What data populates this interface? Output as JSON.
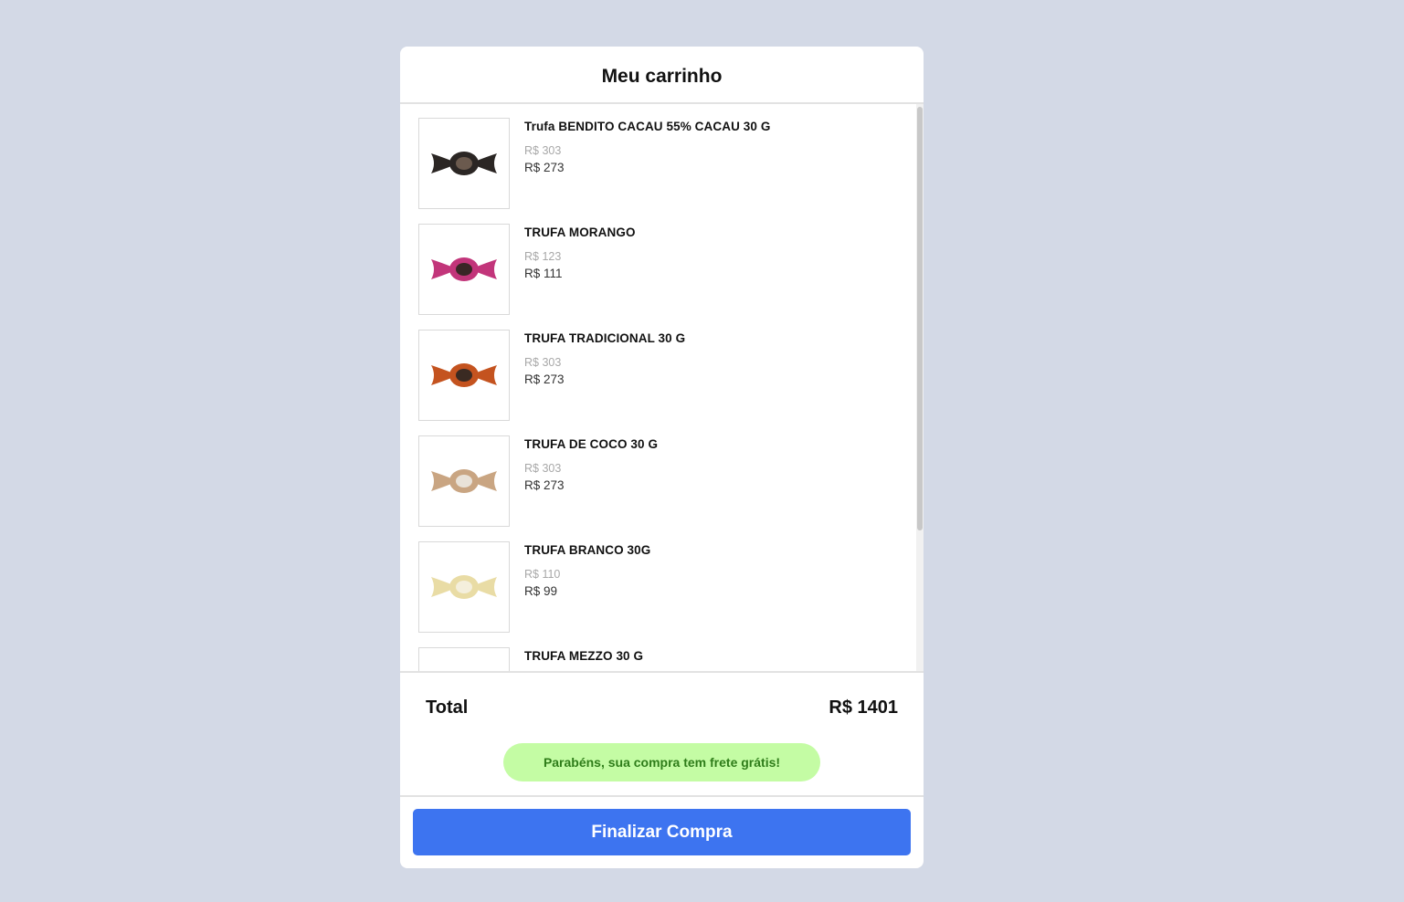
{
  "cart": {
    "title": "Meu carrinho",
    "items": [
      {
        "name": "Trufa BENDITO CACAU 55% CACAU 30 G",
        "old_price": "R$ 303",
        "price": "R$ 273",
        "wrapper_color": "#2b2624",
        "accent_color": "#6b5a4e"
      },
      {
        "name": "TRUFA MORANGO",
        "old_price": "R$ 123",
        "price": "R$ 111",
        "wrapper_color": "#c2357a",
        "accent_color": "#3a2626"
      },
      {
        "name": "TRUFA TRADICIONAL 30 G",
        "old_price": "R$ 303",
        "price": "R$ 273",
        "wrapper_color": "#c4531f",
        "accent_color": "#3a2a22"
      },
      {
        "name": "TRUFA DE COCO 30 G",
        "old_price": "R$ 303",
        "price": "R$ 273",
        "wrapper_color": "#c9a582",
        "accent_color": "#e9e2d8"
      },
      {
        "name": "TRUFA BRANCO 30G",
        "old_price": "R$ 110",
        "price": "R$ 99",
        "wrapper_color": "#e9dca5",
        "accent_color": "#f4efdc"
      },
      {
        "name": "TRUFA MEZZO 30 G",
        "old_price": "",
        "price": "",
        "wrapper_color": "#3a2a22",
        "accent_color": "#6b5a4e"
      }
    ],
    "total_label": "Total",
    "total_value": "R$ 1401",
    "free_shipping_message": "Parabéns, sua compra tem frete grátis!",
    "checkout_label": "Finalizar Compra"
  },
  "colors": {
    "background": "#d3d9e6",
    "accent": "#3d74f0",
    "success_bg": "#c4fca4",
    "success_text": "#2f7d1a"
  }
}
